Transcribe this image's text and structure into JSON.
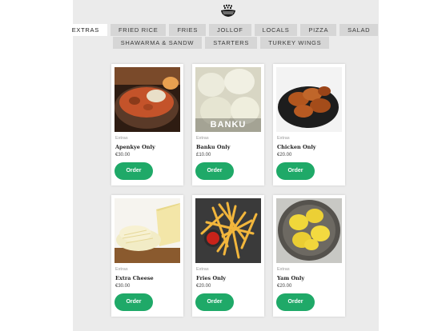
{
  "categories_row1": [
    {
      "label": "EXTRAS",
      "active": true
    },
    {
      "label": "FRIED RICE",
      "active": false
    },
    {
      "label": "FRIES",
      "active": false
    },
    {
      "label": "JOLLOF",
      "active": false
    },
    {
      "label": "LOCALS",
      "active": false
    },
    {
      "label": "PIZZA",
      "active": false
    },
    {
      "label": "SALAD",
      "active": false
    }
  ],
  "categories_row2": [
    {
      "label": "SHAWARMA & SANDW",
      "active": false
    },
    {
      "label": "STARTERS",
      "active": false
    },
    {
      "label": "TURKEY WINGS",
      "active": false
    }
  ],
  "products": [
    {
      "category": "Extras",
      "name": "Apenkye Only",
      "price": "€30.00",
      "button": "Order",
      "image_caption": ""
    },
    {
      "category": "Extras",
      "name": "Banku Only",
      "price": "£10.00",
      "button": "Order",
      "image_caption": "BANKU"
    },
    {
      "category": "Extras",
      "name": "Chicken Only",
      "price": "€20.00",
      "button": "Order",
      "image_caption": ""
    },
    {
      "category": "Extras",
      "name": "Extra Cheese",
      "price": "€30.00",
      "button": "Order",
      "image_caption": ""
    },
    {
      "category": "Extras",
      "name": "Fries Only",
      "price": "€20.00",
      "button": "Order",
      "image_caption": ""
    },
    {
      "category": "Extras",
      "name": "Yam Only",
      "price": "€20.00",
      "button": "Order",
      "image_caption": ""
    }
  ],
  "colors": {
    "panel": "#ebebeb",
    "order_button": "#1fa968",
    "tab_active": "#ffffff",
    "tab": "#d6d6d6"
  },
  "icons": {
    "logo": "food-bowl-icon"
  }
}
